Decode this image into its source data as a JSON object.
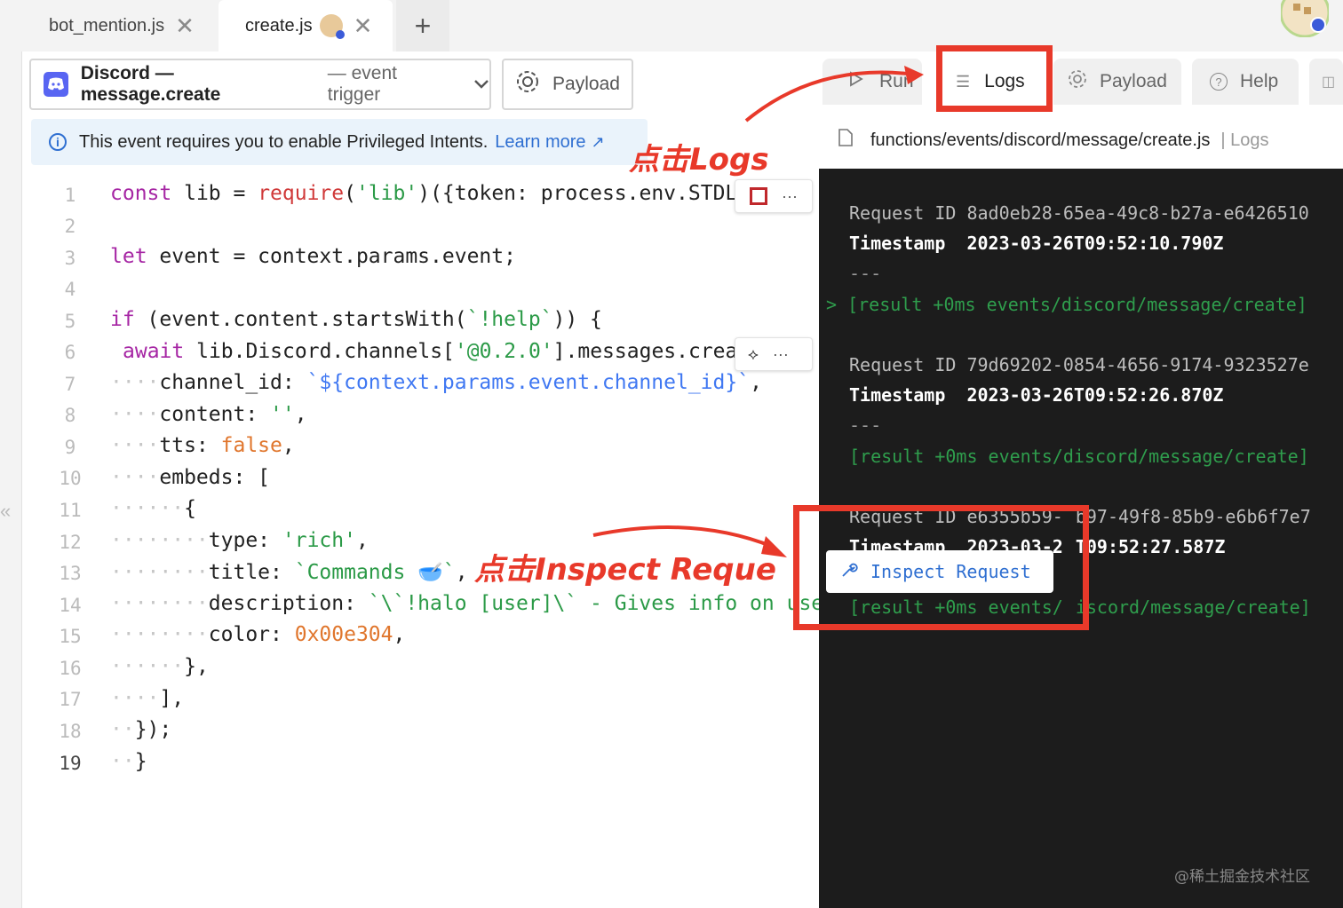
{
  "tabs": [
    {
      "label": "bot_mention.js"
    },
    {
      "label": "create.js"
    }
  ],
  "trigger": {
    "title": "Discord — message.create",
    "sub": "— event trigger"
  },
  "payload_label": "Payload",
  "notice": {
    "text": "This event requires you to enable Privileged Intents.",
    "link": "Learn more"
  },
  "line_numbers": [
    "1",
    "2",
    "3",
    "4",
    "5",
    "6",
    "7",
    "8",
    "9",
    "10",
    "11",
    "12",
    "13",
    "14",
    "15",
    "16",
    "17",
    "18",
    "19"
  ],
  "code": {
    "l1": {
      "kw": "const",
      "a": " lib = ",
      "rq": "require",
      "b": "(",
      "s": "'lib'",
      "c": ")({token: process.env.STDL"
    },
    "l3": {
      "kw": "let",
      "a": " event = context.params.event;"
    },
    "l5": {
      "kw": "if",
      "a": " (event.content.startsWith(",
      "s": "`!help`",
      "b": ")) {"
    },
    "l6": {
      "kw": "await",
      "a": " lib.Discord.channels[",
      "s": "'@0.2.0'",
      "b": "].messages.crea"
    },
    "l7": {
      "d": "····",
      "a": "channel_id: ",
      "s": "`${context.params.event.channel_id}`",
      "b": ","
    },
    "l8": {
      "d": "····",
      "a": "content: ",
      "s": "''",
      "b": ","
    },
    "l9": {
      "d": "····",
      "a": "tts: ",
      "n": "false",
      "b": ","
    },
    "l10": {
      "d": "····",
      "a": "embeds: ["
    },
    "l11": {
      "d": "······",
      "a": "{"
    },
    "l12": {
      "d": "········",
      "a": "type: ",
      "s": "'rich'",
      "b": ","
    },
    "l13": {
      "d": "········",
      "a": "title: ",
      "s": "`Commands 🥣`",
      "b": ","
    },
    "l14": {
      "d": "········",
      "a": "description: ",
      "s": "`\\`!halo [user]\\` - Gives info on use"
    },
    "l15": {
      "d": "········",
      "a": "color: ",
      "n": "0x00e304",
      "b": ","
    },
    "l16": {
      "d": "······",
      "a": "},"
    },
    "l17": {
      "d": "····",
      "a": "],"
    },
    "l18": {
      "d": "··",
      "a": "});"
    },
    "l19": {
      "d": "··",
      "a": "}"
    }
  },
  "right_tabs": [
    {
      "label": "Run"
    },
    {
      "label": "Logs"
    },
    {
      "label": "Payload"
    },
    {
      "label": "Help"
    }
  ],
  "path": {
    "file": "functions/events/discord/message/create.js",
    "suffix": "| Logs"
  },
  "logs": [
    {
      "key": "Request ID",
      "val": "8ad0eb28-65ea-49c8-b27a-e6426510"
    },
    {
      "key": "Timestamp",
      "val": "2023-03-26T09:52:10.790Z"
    },
    {
      "dash": "---"
    },
    {
      "result": "> [result +0ms events/discord/message/create]"
    },
    {
      "key": "Request ID",
      "val": "79d69202-0854-4656-9174-9323527e"
    },
    {
      "key": "Timestamp",
      "val": "2023-03-26T09:52:26.870Z"
    },
    {
      "dash": "---"
    },
    {
      "result": "[result +0ms events/discord/message/create]"
    },
    {
      "key": "Request ID",
      "val": "e6355b59-",
      "val2": "b97-49f8-85b9-e6b6f7e7"
    },
    {
      "key": "Timestamp",
      "val": "2023-03-2",
      "val2": "T09:52:27.587Z"
    },
    {
      "result": "[result +0ms events/",
      "result2": "iscord/message/create]"
    }
  ],
  "inspect_label": "Inspect Request",
  "annotations": {
    "logs": "点击Logs",
    "inspect": "点击Inspect Reque"
  },
  "watermark": "@稀土掘金技术社区",
  "colors": {
    "highlight": "#e8392a",
    "discord": "#5865f2",
    "link": "#2f6fd1"
  }
}
